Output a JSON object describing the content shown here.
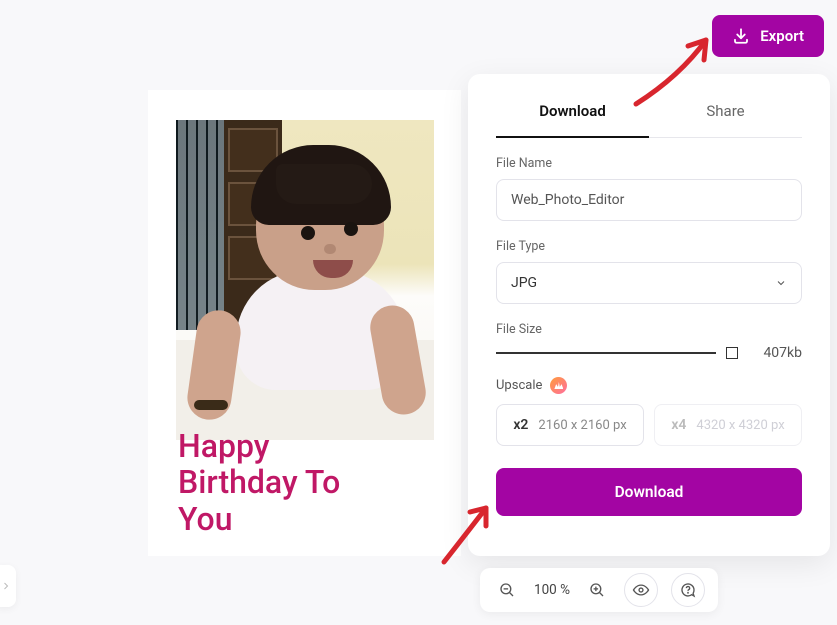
{
  "export_button": {
    "label": "Export"
  },
  "canvas": {
    "greeting": {
      "line1": "Happy",
      "line2": "Birthday To",
      "line3": "You"
    }
  },
  "panel": {
    "tabs": {
      "download": "Download",
      "share": "Share"
    },
    "file_name": {
      "label": "File Name",
      "value": "Web_Photo_Editor"
    },
    "file_type": {
      "label": "File Type",
      "value": "JPG"
    },
    "file_size": {
      "label": "File Size",
      "value": "407kb"
    },
    "upscale": {
      "label": "Upscale",
      "options": [
        {
          "mult": "x2",
          "dim": "2160 x 2160 px"
        },
        {
          "mult": "x4",
          "dim": "4320 x 4320 px"
        }
      ]
    },
    "download_button": "Download"
  },
  "bottom": {
    "zoom": "100 %"
  }
}
